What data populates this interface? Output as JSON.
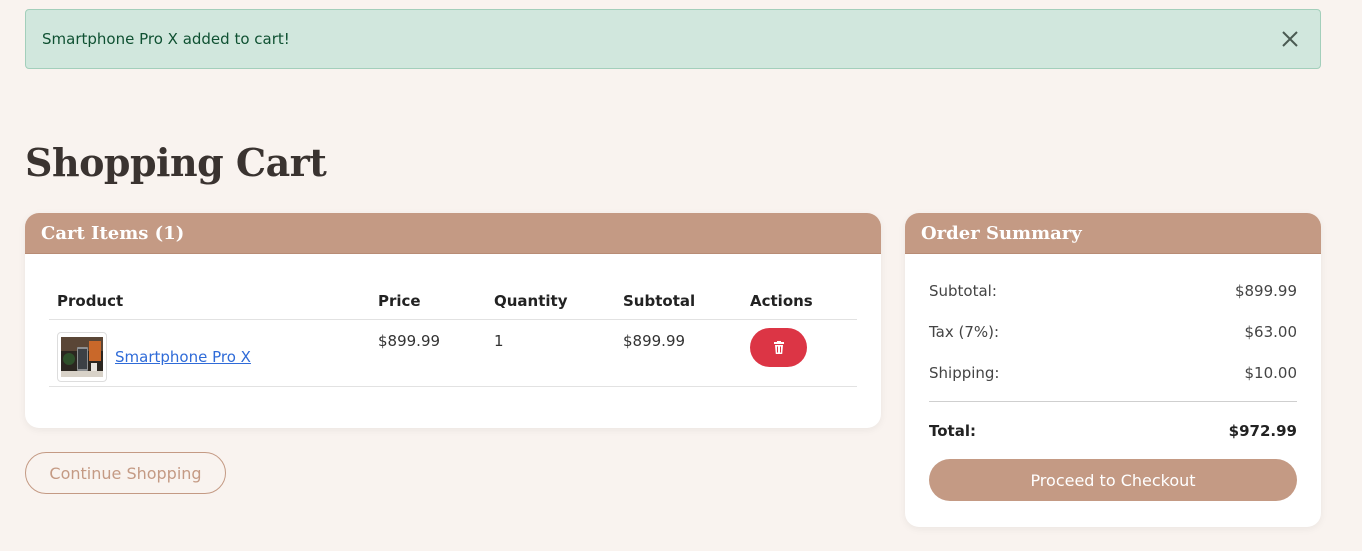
{
  "alert": {
    "message": "Smartphone Pro X added to cart!",
    "close_icon": "close-icon"
  },
  "page": {
    "title": "Shopping Cart"
  },
  "cart": {
    "header": "Cart Items (1)",
    "columns": [
      "Product",
      "Price",
      "Quantity",
      "Subtotal",
      "Actions"
    ],
    "items": [
      {
        "name": "Smartphone Pro X",
        "price": "$899.99",
        "quantity": "1",
        "subtotal": "$899.99",
        "action_icon": "trash-icon"
      }
    ]
  },
  "continue_label": "Continue Shopping",
  "summary": {
    "header": "Order Summary",
    "rows": [
      {
        "label": "Subtotal:",
        "value": "$899.99"
      },
      {
        "label": "Tax (7%):",
        "value": "$63.00"
      },
      {
        "label": "Shipping:",
        "value": "$10.00"
      }
    ],
    "total_label": "Total:",
    "total_value": "$972.99",
    "checkout_label": "Proceed to Checkout"
  },
  "colors": {
    "accent": "#c49a84",
    "danger": "#dc3545",
    "alert_bg": "#d1e7dd",
    "link": "#2f6bd8"
  }
}
